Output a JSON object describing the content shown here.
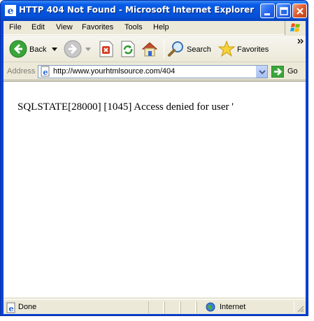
{
  "window": {
    "title": "HTTP 404 Not Found - Microsoft Internet Explorer"
  },
  "menu": {
    "items": [
      "File",
      "Edit",
      "View",
      "Favorites",
      "Tools",
      "Help"
    ]
  },
  "toolbar": {
    "back_label": "Back",
    "search_label": "Search",
    "favorites_label": "Favorites"
  },
  "address": {
    "label": "Address",
    "url": "http://www.yourhtmlsource.com/404",
    "go_label": "Go"
  },
  "page": {
    "error_message": "SQLSTATE[28000] [1045] Access denied for user '"
  },
  "status": {
    "left_text": "Done",
    "zone_text": "Internet"
  },
  "colors": {
    "titlebar": "#0656e0",
    "chrome": "#ece9d8",
    "close_button": "#de5a2c"
  }
}
